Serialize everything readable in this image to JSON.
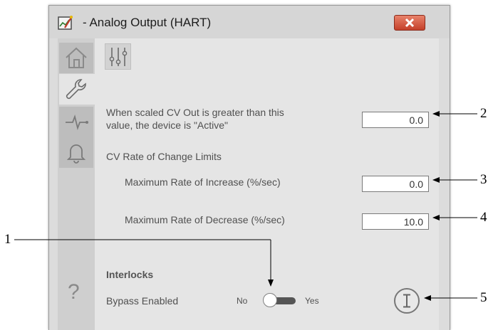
{
  "window": {
    "title": "- Analog Output (HART)"
  },
  "nav": {
    "items": [
      "home-icon",
      "wrench-icon",
      "trend-icon",
      "bell-icon"
    ],
    "help": "?"
  },
  "tab": {
    "icon": "sliders-icon"
  },
  "settings": {
    "active_label_line1": "When scaled CV Out is greater than this",
    "active_label_line2": "value, the device is \"Active\"",
    "active_value": "0.0",
    "rate_heading": "CV Rate of Change Limits",
    "increase_label": "Maximum Rate of Increase (%/sec)",
    "increase_value": "0.0",
    "decrease_label": "Maximum Rate of Decrease (%/sec)",
    "decrease_value": "10.0"
  },
  "interlocks": {
    "heading": "Interlocks",
    "bypass_label": "Bypass Enabled",
    "no_label": "No",
    "yes_label": "Yes",
    "bypass_enabled": false
  },
  "callouts": [
    "1",
    "2",
    "3",
    "4",
    "5"
  ],
  "colors": {
    "close_button": "#c4402a",
    "panel_bg": "#e5e5e5",
    "nav_bg": "#cfcfcf"
  }
}
